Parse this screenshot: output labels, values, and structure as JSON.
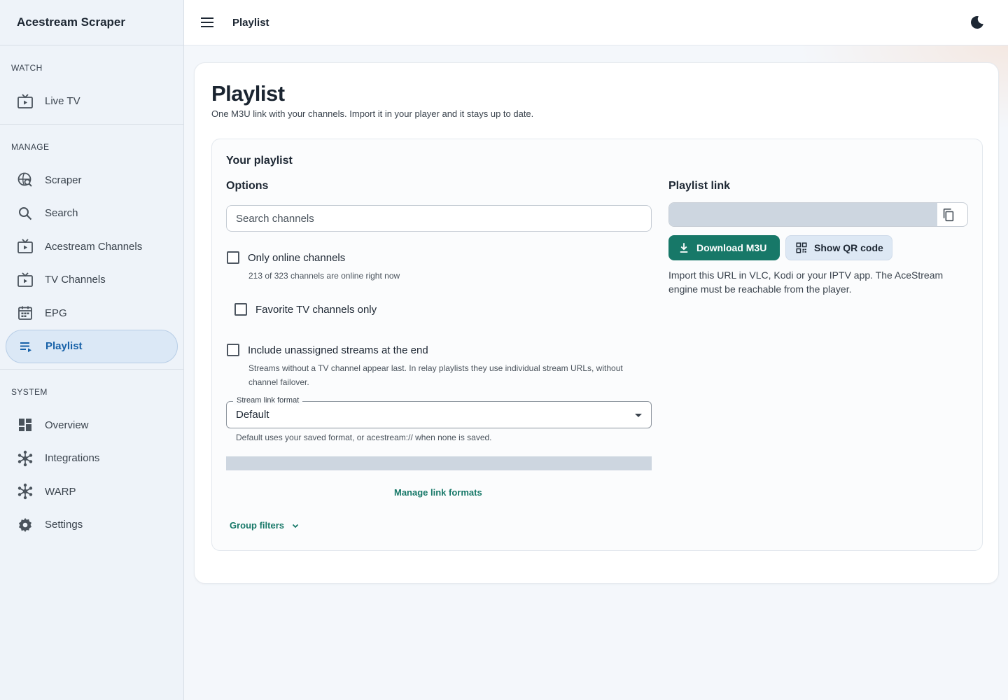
{
  "app": {
    "title": "Acestream Scraper"
  },
  "sidebar": {
    "sections": [
      {
        "label": "WATCH",
        "items": [
          {
            "label": "Live TV",
            "icon": "tv-play-icon"
          }
        ]
      },
      {
        "label": "MANAGE",
        "items": [
          {
            "label": "Scraper",
            "icon": "globe-search-icon"
          },
          {
            "label": "Search",
            "icon": "search-icon"
          },
          {
            "label": "Acestream Channels",
            "icon": "tv-play-icon"
          },
          {
            "label": "TV Channels",
            "icon": "tv-play-icon"
          },
          {
            "label": "EPG",
            "icon": "calendar-icon"
          },
          {
            "label": "Playlist",
            "icon": "playlist-icon",
            "active": true
          }
        ]
      },
      {
        "label": "SYSTEM",
        "items": [
          {
            "label": "Overview",
            "icon": "dashboard-icon"
          },
          {
            "label": "Integrations",
            "icon": "hub-icon"
          },
          {
            "label": "WARP",
            "icon": "hub-icon"
          },
          {
            "label": "Settings",
            "icon": "gear-icon"
          }
        ]
      }
    ]
  },
  "topbar": {
    "title": "Playlist"
  },
  "page": {
    "title": "Playlist",
    "subtitle": "One M3U link with your channels. Import it in your player and it stays up to date."
  },
  "playlist_panel": {
    "heading": "Your playlist",
    "options_heading": "Options",
    "search_placeholder": "Search channels",
    "only_online": {
      "label": "Only online channels",
      "checked": false,
      "help": "213 of 323 channels are online right now"
    },
    "favorites": {
      "label": "Favorite TV channels only",
      "checked": false
    },
    "unassigned": {
      "label": "Include unassigned streams at the end",
      "checked": false,
      "help_line1": "Streams without a TV channel appear last. In relay playlists they use individual stream URLs, without",
      "help_line2": "channel failover."
    },
    "stream_format": {
      "legend": "Stream link format",
      "value": "Default",
      "help": "Default uses your saved format, or acestream:// when none is saved."
    },
    "manage_formats": "Manage link formats",
    "group_filters": "Group filters"
  },
  "link_panel": {
    "heading": "Playlist link",
    "download_label": "Download M3U",
    "qr_label": "Show QR code",
    "help_line1": "Import this URL in VLC, Kodi or your IPTV app. The AceStream",
    "help_line2": "engine must be reachable from the player."
  },
  "colors": {
    "accent": "#177868",
    "active_nav": "#1761a8",
    "active_nav_bg": "#dbe8f6"
  }
}
